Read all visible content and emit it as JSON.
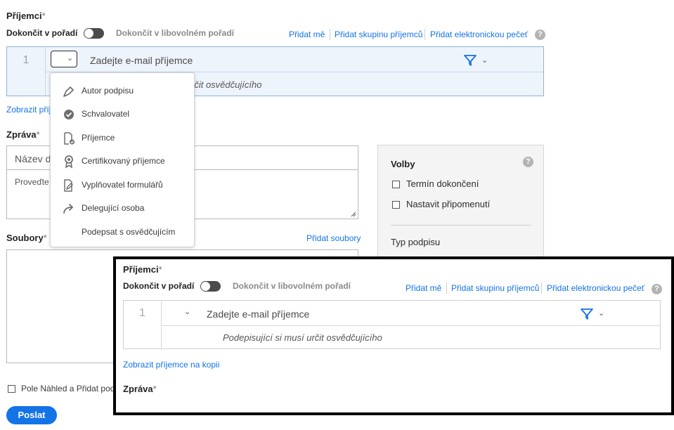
{
  "recipients": {
    "heading": "Příjemci",
    "required_mark": "*",
    "order_label_active": "Dokončit v pořadí",
    "order_label_inactive": "Dokončit v libovolném pořadí",
    "add_me": "Přidat mě",
    "add_group": "Přidat skupinu příjemců",
    "add_seal": "Přidat elektronickou pečeť",
    "help": "?",
    "row_number": "1",
    "email_placeholder": "Zadejte e-mail příjemce",
    "partial_note": "rčit osvědčujícího",
    "show_cc_partial": "Zobrazit příj"
  },
  "role_menu": {
    "items": [
      {
        "label": "Autor podpisu",
        "icon": "pen-icon"
      },
      {
        "label": "Schvalovatel",
        "icon": "approver-check-icon"
      },
      {
        "label": "Příjemce",
        "icon": "acceptor-document-icon"
      },
      {
        "label": "Certifikovaný příjemce",
        "icon": "certified-ribbon-icon"
      },
      {
        "label": "Vyplňovatel formulářů",
        "icon": "form-filler-icon"
      },
      {
        "label": "Delegující osoba",
        "icon": "delegate-arrow-icon"
      },
      {
        "label": "Podepsat s osvědčujícím",
        "icon": ""
      }
    ]
  },
  "message": {
    "heading": "Zpráva",
    "required_mark": "*",
    "name_partial": "Název do",
    "body_partial": "Proveďte"
  },
  "files": {
    "heading": "Soubory",
    "required_mark": "*",
    "add_files": "Přidat soubory"
  },
  "options": {
    "heading": "Volby",
    "help": "?",
    "deadline": "Termín dokončení",
    "reminder": "Nastavit připomenutí",
    "signature_type": "Typ podpisu"
  },
  "preview_fields_partial": "Pole Náhled a Přidat podp",
  "send_button": "Poslat",
  "zoom_inset": {
    "heading": "Příjemci",
    "required_mark": "*",
    "order_label_active": "Dokončit v pořadí",
    "order_label_inactive": "Dokončit v libovolném pořadí",
    "add_me": "Přidat mě",
    "add_group": "Přidat skupinu příjemců",
    "add_seal": "Přidat elektronickou pečeť",
    "help": "?",
    "row_number": "1",
    "email_placeholder": "Zadejte e-mail příjemce",
    "signer_note": "Podepisující si musí určit osvědčujícího",
    "show_cc": "Zobrazit příjemce na kopii",
    "message_heading": "Zpráva",
    "message_required_mark": "*"
  },
  "colors": {
    "accent": "#1473e6",
    "recipient_bg": "#eef4fb",
    "recipient_border": "#8fb3d6",
    "panel_bg": "#f4f4f4"
  }
}
